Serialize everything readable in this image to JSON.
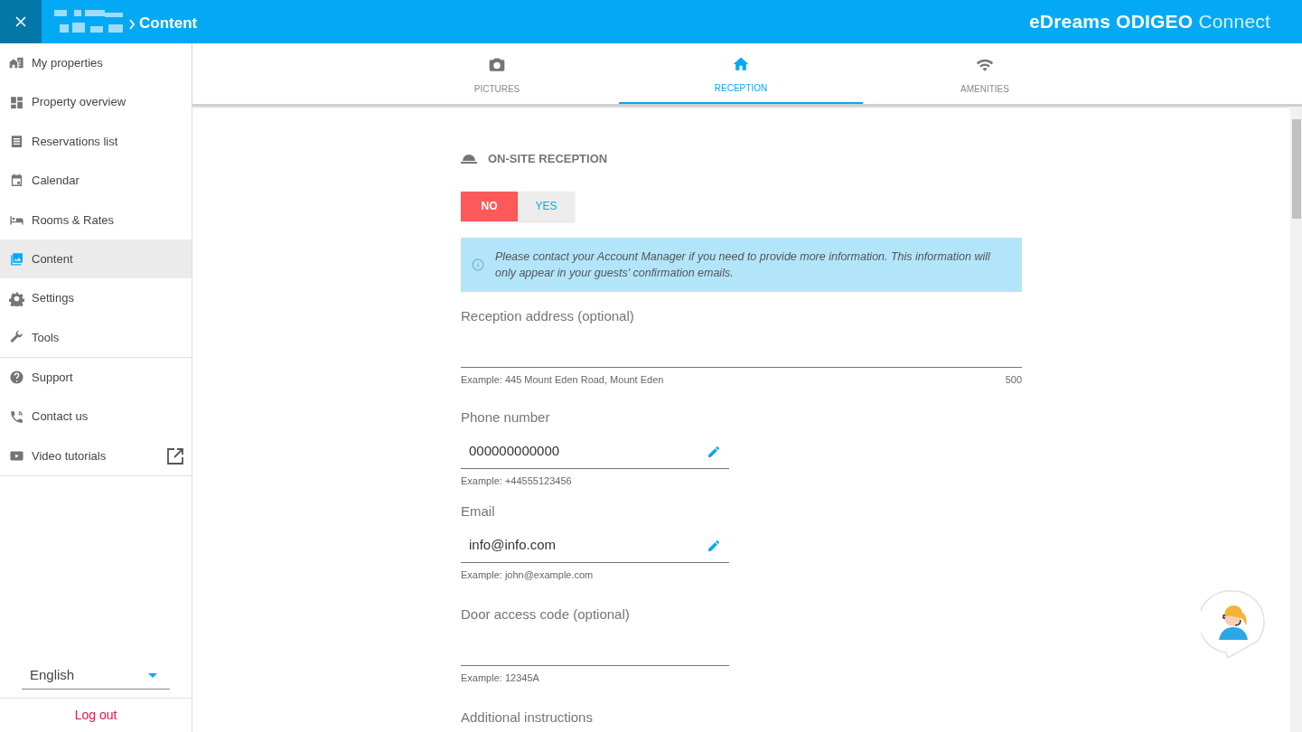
{
  "header": {
    "breadcrumb_current": "Content",
    "brand_bold": "eDreams ODIGEO",
    "brand_light": "Connect"
  },
  "sidebar": {
    "groups": [
      {
        "items": [
          {
            "label": "My properties",
            "selected": false
          },
          {
            "label": "Property overview",
            "selected": false
          },
          {
            "label": "Reservations list",
            "selected": false
          },
          {
            "label": "Calendar",
            "selected": false
          },
          {
            "label": "Rooms & Rates",
            "selected": false
          },
          {
            "label": "Content",
            "selected": true
          },
          {
            "label": "Settings",
            "selected": false
          },
          {
            "label": "Tools",
            "selected": false
          }
        ]
      },
      {
        "items": [
          {
            "label": "Support",
            "selected": false
          },
          {
            "label": "Contact us",
            "selected": false
          },
          {
            "label": "Video tutorials",
            "selected": false,
            "external": true
          }
        ]
      }
    ],
    "language": "English",
    "logout": "Log out"
  },
  "tabs": [
    {
      "label": "PICTURES",
      "selected": false
    },
    {
      "label": "RECEPTION",
      "selected": true
    },
    {
      "label": "AMENITIES",
      "selected": false
    }
  ],
  "section": {
    "title": "ON-SITE RECEPTION",
    "toggle": [
      {
        "label": "NO",
        "selected": true
      },
      {
        "label": "YES",
        "selected": false
      }
    ],
    "info": "Please contact your Account Manager if you need to provide more information. This information will only appear in your guests' confirmation emails.",
    "fields": [
      {
        "kind": "wide",
        "label": "Reception address (optional)",
        "hint": "Example: 445 Mount Eden Road, Mount Eden",
        "counter": "500"
      },
      {
        "kind": "short",
        "label": "Phone number",
        "value": "000000000000",
        "hint": "Example: +44555123456",
        "editable": true
      },
      {
        "kind": "short",
        "label": "Email",
        "value": "info@info.com",
        "hint": "Example: john@example.com",
        "editable": true
      },
      {
        "kind": "short",
        "label": "Door access code (optional)",
        "hint": "Example: 12345A"
      },
      {
        "kind": "partial",
        "label": "Additional instructions"
      }
    ]
  }
}
